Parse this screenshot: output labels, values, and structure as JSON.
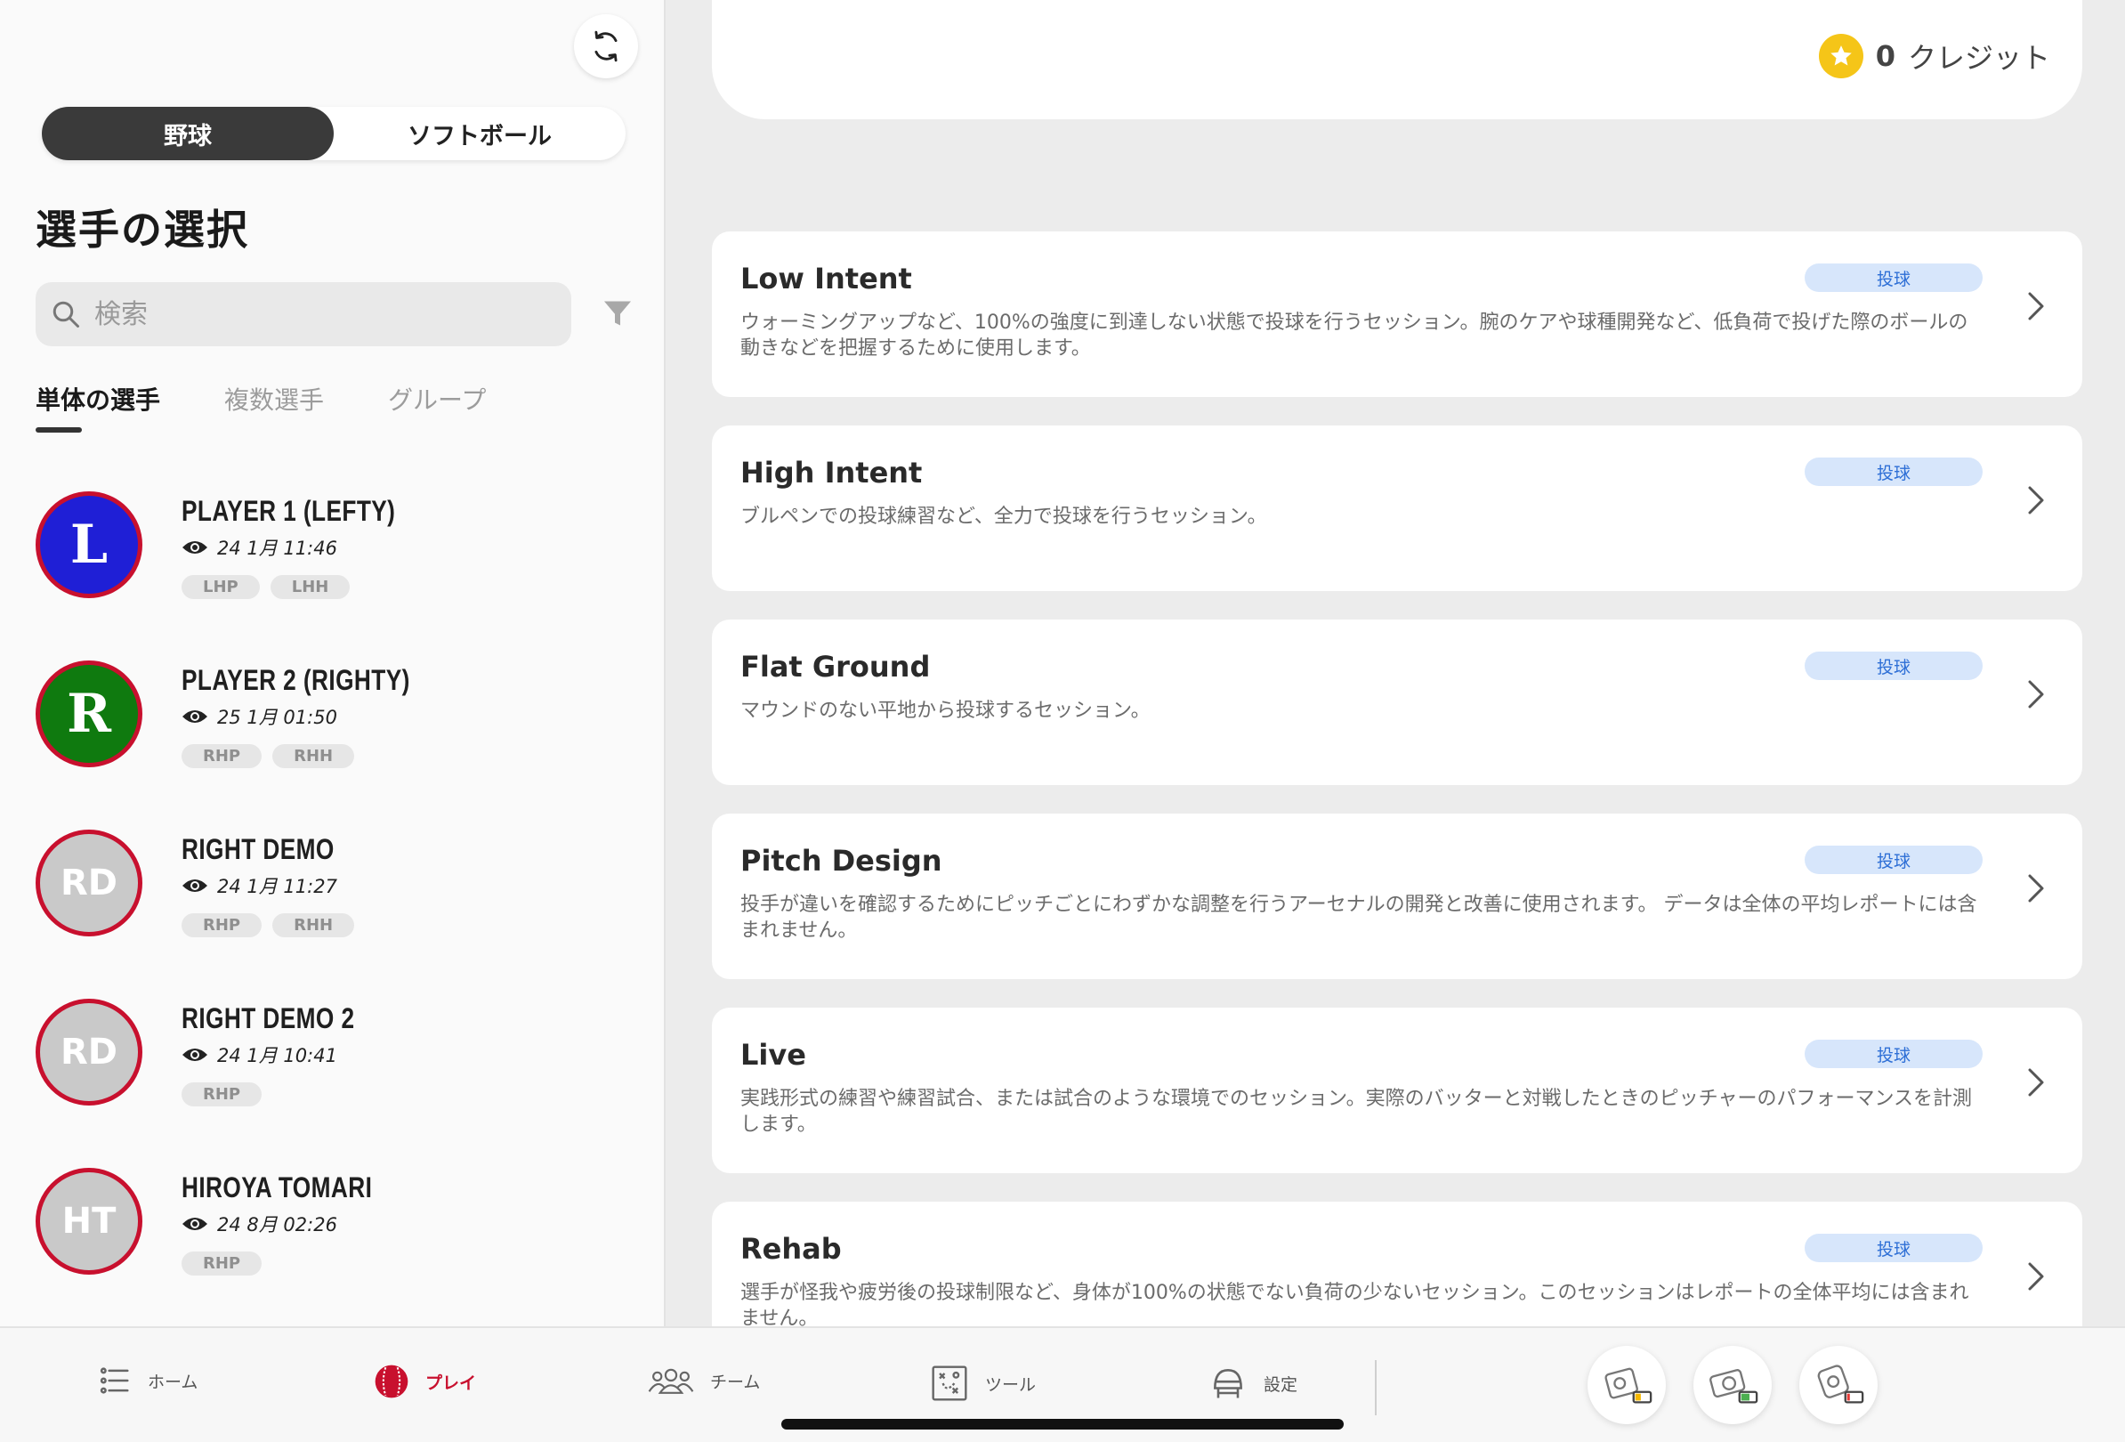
{
  "sidebar": {
    "sport_toggle": [
      {
        "label": "野球",
        "active": true
      },
      {
        "label": "ソフトボール",
        "active": false
      }
    ],
    "title": "選手の選択",
    "search": {
      "placeholder": "検索",
      "value": ""
    },
    "tabs": [
      {
        "label": "単体の選手",
        "active": true
      },
      {
        "label": "複数選手",
        "active": false
      },
      {
        "label": "グループ",
        "active": false
      }
    ],
    "players": [
      {
        "name": "PLAYER 1 (LEFTY)",
        "initials": "L",
        "avatar_color": "#1f1fd6",
        "avatar_style": "letter",
        "last_seen": "24 1月 11:46",
        "tags": [
          "LHP",
          "LHH"
        ]
      },
      {
        "name": "PLAYER 2 (RIGHTY)",
        "initials": "R",
        "avatar_color": "#0f7a0f",
        "avatar_style": "letter",
        "last_seen": "25 1月 01:50",
        "tags": [
          "RHP",
          "RHH"
        ]
      },
      {
        "name": "RIGHT DEMO",
        "initials": "RD",
        "avatar_color": "#c9c9c9",
        "avatar_style": "initials",
        "last_seen": "24 1月 11:27",
        "tags": [
          "RHP",
          "RHH"
        ]
      },
      {
        "name": "RIGHT DEMO 2",
        "initials": "RD",
        "avatar_color": "#c9c9c9",
        "avatar_style": "initials",
        "last_seen": "24 1月 10:41",
        "tags": [
          "RHP"
        ]
      },
      {
        "name": "HIROYA TOMARI",
        "initials": "HT",
        "avatar_color": "#c9c9c9",
        "avatar_style": "initials",
        "last_seen": "24 8月 02:26",
        "tags": [
          "RHP"
        ]
      }
    ]
  },
  "header": {
    "credits_value": "0",
    "credits_label": "クレジット"
  },
  "sessions": [
    {
      "title": "Low Intent",
      "badge": "投球",
      "description": "ウォーミングアップなど、100%の強度に到達しない状態で投球を行うセッション。腕のケアや球種開発など、低負荷で投げた際のボールの動きなどを把握するために使用します。"
    },
    {
      "title": "High Intent",
      "badge": "投球",
      "description": "ブルペンでの投球練習など、全力で投球を行うセッション。"
    },
    {
      "title": "Flat Ground",
      "badge": "投球",
      "description": "マウンドのない平地から投球するセッション。"
    },
    {
      "title": "Pitch Design",
      "badge": "投球",
      "description": "投手が違いを確認するためにピッチごとにわずかな調整を行うアーセナルの開発と改善に使用されます。 データは全体の平均レポートには含まれません。"
    },
    {
      "title": "Live",
      "badge": "投球",
      "description": "実践形式の練習や練習試合、または試合のような環境でのセッション。実際のバッターと対戦したときのピッチャーのパフォーマンスを計測します。"
    },
    {
      "title": "Rehab",
      "badge": "投球",
      "description": "選手が怪我や疲労後の投球制限など、身体が100%の状態でない負荷の少ないセッション。このセッションはレポートの全体平均には含まれません。"
    }
  ],
  "bottom_nav": {
    "items": [
      {
        "label": "ホーム",
        "icon": "list-icon",
        "active": false
      },
      {
        "label": "プレイ",
        "icon": "baseball-icon",
        "active": true
      },
      {
        "label": "チーム",
        "icon": "team-icon",
        "active": false
      },
      {
        "label": "ツール",
        "icon": "tactics-board-icon",
        "active": false
      },
      {
        "label": "設定",
        "icon": "helmet-icon",
        "active": false
      }
    ],
    "devices": [
      {
        "icon": "camera-device-icon",
        "battery_level": 0.4,
        "battery_color": "#f5b800"
      },
      {
        "icon": "radar-device-icon",
        "battery_level": 0.6,
        "battery_color": "#4caf50"
      },
      {
        "icon": "tracker-device-icon",
        "battery_level": 0.2,
        "battery_color": "#e53935"
      }
    ]
  },
  "colors": {
    "accent_red": "#c8102e",
    "badge_bg": "#d7e6fb",
    "badge_text": "#2e6fd6",
    "coin": "#f5c518"
  }
}
